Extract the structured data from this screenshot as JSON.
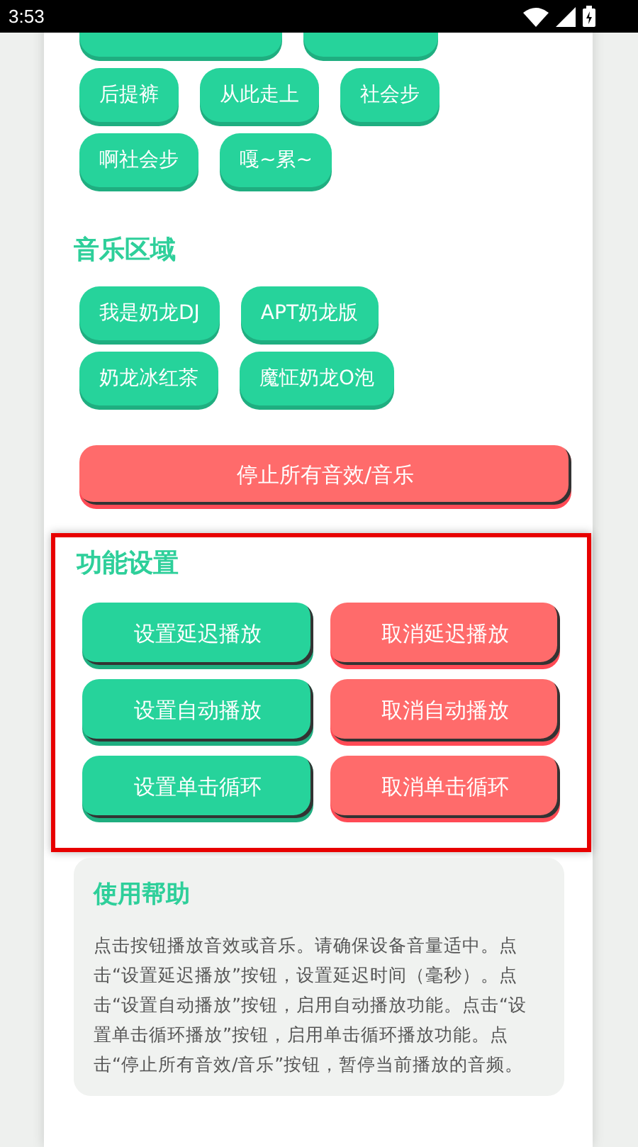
{
  "status_bar": {
    "time": "3:53"
  },
  "clipped_buttons": [
    {
      "kind": "wide"
    },
    {
      "kind": "narrow"
    }
  ],
  "sound_rows": [
    [
      "后提裤",
      "从此走上",
      "社会步"
    ],
    [
      "啊社会步",
      "嘎~累~"
    ]
  ],
  "music_section": {
    "title": "音乐区域",
    "rows": [
      [
        "我是奶龙DJ",
        "APT奶龙版"
      ],
      [
        "奶龙冰红茶",
        "魔怔奶龙O泡"
      ]
    ]
  },
  "stop_button": "停止所有音效/音乐",
  "settings_section": {
    "title": "功能设置",
    "highlighted": true,
    "buttons": [
      {
        "label": "设置延迟播放",
        "kind": "set"
      },
      {
        "label": "取消延迟播放",
        "kind": "cancel"
      },
      {
        "label": "设置自动播放",
        "kind": "set"
      },
      {
        "label": "取消自动播放",
        "kind": "cancel"
      },
      {
        "label": "设置单击循环",
        "kind": "set"
      },
      {
        "label": "取消单击循环",
        "kind": "cancel"
      }
    ]
  },
  "help": {
    "title": "使用帮助",
    "text": "点击按钮播放音效或音乐。请确保设备音量适中。点击“设置延迟播放”按钮，设置延迟时间（毫秒）。点击“设置自动播放”按钮，启用自动播放功能。点击“设置单击循环播放”按钮，启用单击循环播放功能。点击“停止所有音效/音乐”按钮，暂停当前播放的音频。"
  }
}
